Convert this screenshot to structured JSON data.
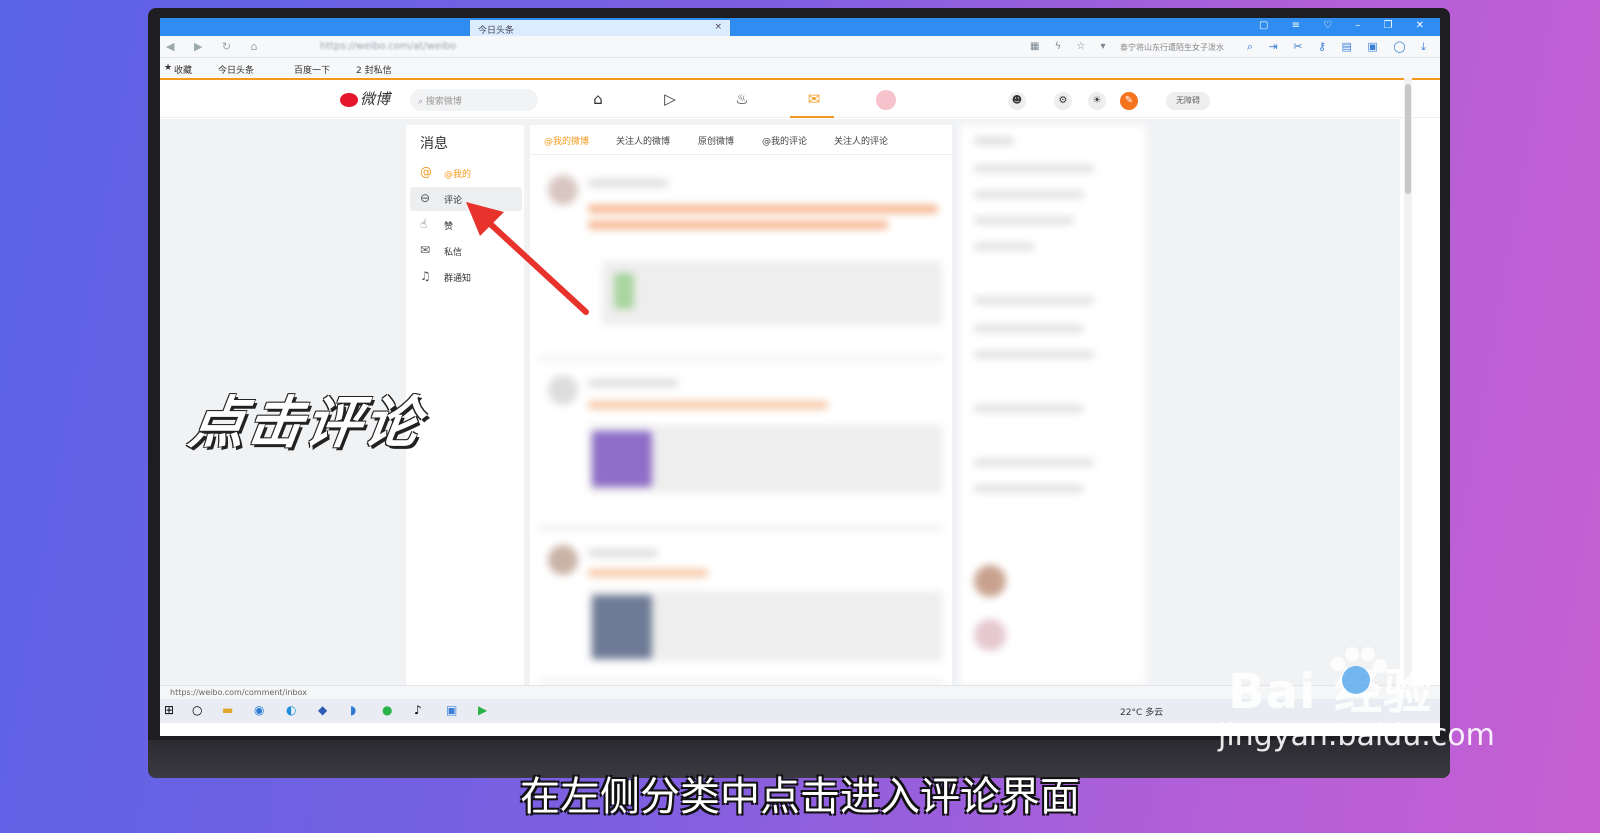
{
  "browser": {
    "tab_title": "今日头条",
    "tab_close": "×",
    "url": "https://weibo.com/at/weibo",
    "hot_search": "泰宁将山东行遭陌生女子泼水",
    "bookmarks": [
      "收藏",
      "今日头条",
      "百度一下",
      "2 封私信"
    ]
  },
  "weibo": {
    "logo_text": "微博",
    "search_placeholder": "搜索微博",
    "nav_icons": [
      "home-icon",
      "video-icon",
      "hot-icon",
      "message-icon",
      "avatar"
    ],
    "accessibility": "无障碍",
    "accent": "#f39a1c"
  },
  "sidebar": {
    "title": "消息",
    "items": [
      {
        "label": "@我的",
        "icon": "at-icon"
      },
      {
        "label": "评论",
        "icon": "comment-icon"
      },
      {
        "label": "赞",
        "icon": "like-icon"
      },
      {
        "label": "私信",
        "icon": "mail-icon"
      },
      {
        "label": "群通知",
        "icon": "bell-icon"
      }
    ]
  },
  "feed_tabs": [
    "@我的微博",
    "关注人的微博",
    "原创微博",
    "@我的评论",
    "关注人的评论"
  ],
  "statusbar": {
    "url": "https://weibo.com/comment/inbox"
  },
  "taskbar": {
    "weather": "22°C 多云"
  },
  "overlay": {
    "step": "点击评论",
    "caption": "在左侧分类中点击进入评论界面"
  },
  "watermark": {
    "brand": "Bai 经验",
    "domain": "jingyan.baidu.com"
  }
}
